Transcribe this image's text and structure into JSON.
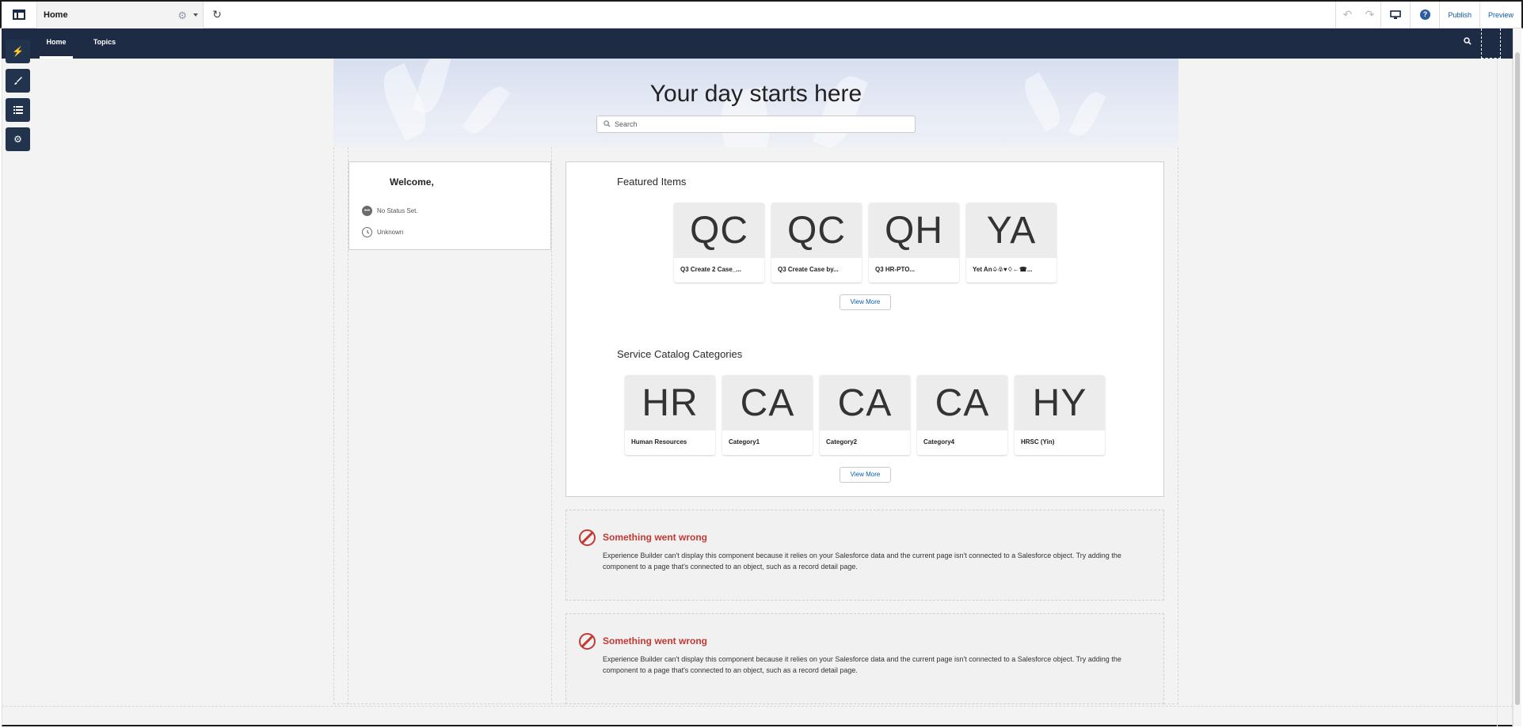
{
  "toolbar": {
    "page_name": "Home",
    "publish_label": "Publish",
    "preview_label": "Preview"
  },
  "nav": {
    "tabs": [
      {
        "label": "Home",
        "active": true
      },
      {
        "label": "Topics",
        "active": false
      }
    ]
  },
  "hero": {
    "title": "Your day starts here",
    "search_placeholder": "Search"
  },
  "welcome": {
    "heading": "Welcome,",
    "status": "No Status Set.",
    "timezone": "Unknown"
  },
  "featured": {
    "title": "Featured Items",
    "items": [
      {
        "initials": "QC",
        "label": "Q3 Create 2 Case_..."
      },
      {
        "initials": "QC",
        "label": "Q3 Create Case by..."
      },
      {
        "initials": "QH",
        "label": "Q3 HR-PTO..."
      },
      {
        "initials": "YA",
        "label": "Yet An♤♧♥♢←☎..."
      }
    ],
    "view_more": "View More"
  },
  "catalog": {
    "title": "Service Catalog Categories",
    "items": [
      {
        "initials": "HR",
        "label": "Human Resources"
      },
      {
        "initials": "CA",
        "label": "Category1"
      },
      {
        "initials": "CA",
        "label": "Category2"
      },
      {
        "initials": "CA",
        "label": "Category4"
      },
      {
        "initials": "HY",
        "label": "HRSC (Yin)"
      }
    ],
    "view_more": "View More"
  },
  "errors": [
    {
      "title": "Something went wrong",
      "body": "Experience Builder can't display this component because it relies on your Salesforce data and the current page isn't connected to a Salesforce object. Try adding the component to a page that's connected to an object, such as a record detail page."
    },
    {
      "title": "Something went wrong",
      "body": "Experience Builder can't display this component because it relies on your Salesforce data and the current page isn't connected to a Salesforce object. Try adding the component to a page that's connected to an object, such as a record detail page."
    }
  ],
  "colors": {
    "nav_bg": "#1d2b45",
    "error_red": "#c23934",
    "link_blue": "#0b5cab"
  }
}
